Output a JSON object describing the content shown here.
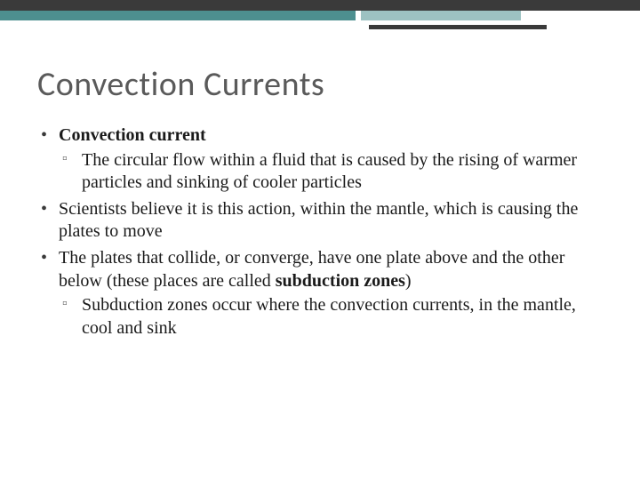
{
  "title": "Convection Currents",
  "bullets": {
    "item1": {
      "label": "Convection current"
    },
    "item1_sub1": "The circular flow within a fluid that is caused by the rising of warmer particles and sinking of cooler particles",
    "item2": "Scientists believe it is this action, within the mantle, which is causing the plates to move",
    "item3_prefix": "The plates that collide, or converge, have one plate above and the other below (these places are called ",
    "item3_bold": "subduction zones",
    "item3_suffix": ")",
    "item3_sub1": "Subduction zones occur where the convection currents, in the mantle, cool and sink"
  }
}
